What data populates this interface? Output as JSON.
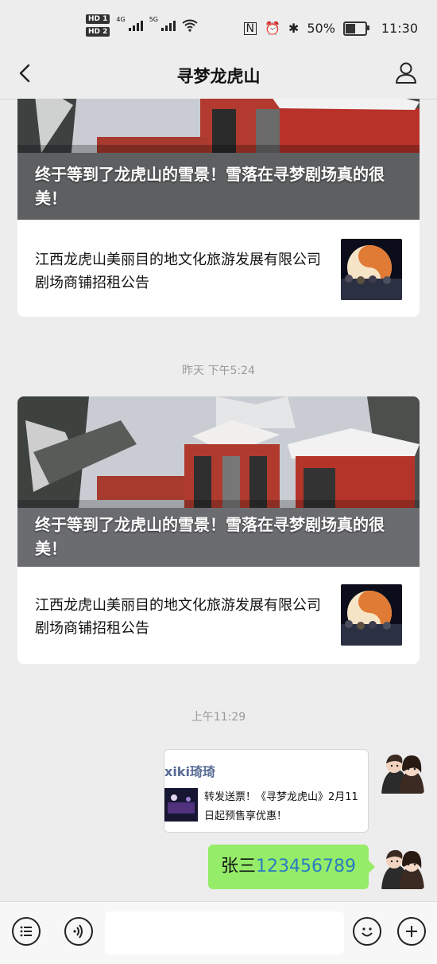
{
  "status": {
    "hd1": "HD 1",
    "hd2": "HD 2",
    "net1": "4G",
    "net2": "5G",
    "battery": "50%",
    "time": "11:30"
  },
  "header": {
    "title": "寻梦龙虎山"
  },
  "cards": [
    {
      "hero_title": "终于等到了龙虎山的雪景！雪落在寻梦剧场真的很美！",
      "subtitle": "江西龙虎山美丽目的地文化旅游发展有限公司剧场商铺招租公告"
    },
    {
      "hero_title": "终于等到了龙虎山的雪景！雪落在寻梦剧场真的很美！",
      "subtitle": "江西龙虎山美丽目的地文化旅游发展有限公司剧场商铺招租公告"
    }
  ],
  "timestamps": {
    "t1": "昨天 下午5:24",
    "t2": "上午11:29"
  },
  "forward": {
    "name": "xiki琦琦",
    "text": "转发送票！《寻梦龙虎山》2月11日起预售享优惠！"
  },
  "message": {
    "name": "张三",
    "number": "123456789"
  },
  "colors": {
    "bubble": "#95ec69",
    "link": "#576b95",
    "background": "#ededed"
  },
  "icons": [
    "back-arrow-icon",
    "person-icon",
    "menu-icon",
    "voice-icon",
    "emoji-icon",
    "plus-icon"
  ]
}
